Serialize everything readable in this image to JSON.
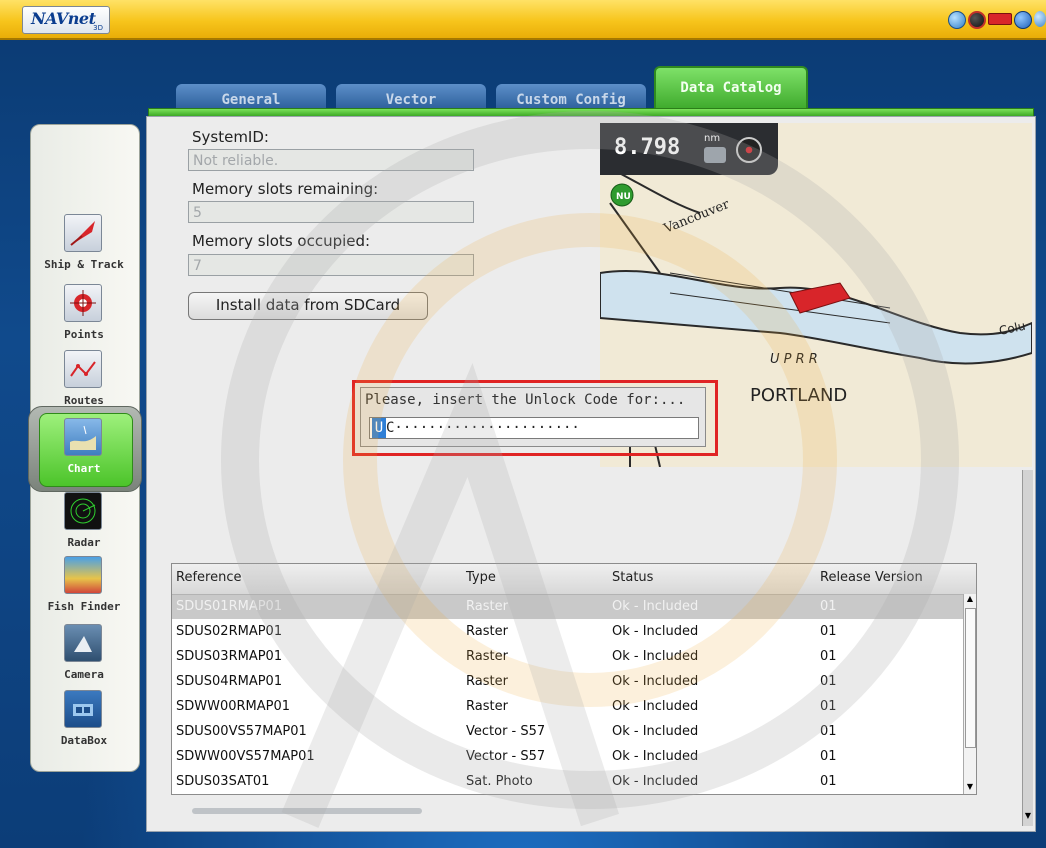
{
  "app": {
    "logo": "NAVnet",
    "logo_sub": "3D"
  },
  "status_icons": [
    {
      "name": "globe-icon",
      "color": "#4a9be0"
    },
    {
      "name": "compass-icon",
      "color": "#c0302a"
    },
    {
      "name": "boat-icon",
      "color": "#d8252a"
    },
    {
      "name": "gps-icon",
      "color": "#2a74d0"
    },
    {
      "name": "sun-icon",
      "color": "#5aa1d8"
    }
  ],
  "tabs": [
    {
      "label": "General"
    },
    {
      "label": "Vector"
    },
    {
      "label": "Custom Config"
    },
    {
      "label": "Data Catalog",
      "active": true
    }
  ],
  "sidebar": {
    "items": [
      {
        "label": "Ship & Track",
        "icon": "ship-track-icon"
      },
      {
        "label": "Points",
        "icon": "points-icon"
      },
      {
        "label": "Routes",
        "icon": "routes-icon"
      },
      {
        "label": "Chart",
        "icon": "chart-icon",
        "active": true
      },
      {
        "label": "Radar",
        "icon": "radar-icon"
      },
      {
        "label": "Fish Finder",
        "icon": "fish-finder-icon"
      },
      {
        "label": "Camera",
        "icon": "camera-icon"
      },
      {
        "label": "DataBox",
        "icon": "databox-icon"
      }
    ]
  },
  "form": {
    "system_id_label": "SystemID:",
    "system_id_value": "Not reliable.",
    "remaining_label": "Memory slots remaining:",
    "remaining_value": "5",
    "occupied_label": "Memory slots occupied:",
    "occupied_value": "7",
    "install_button": "Install data from SDCard"
  },
  "map": {
    "scale_value": "8.798",
    "scale_unit": "nm",
    "labels": [
      "Vancouver",
      "PORTLAND",
      "U P R R",
      "Colu"
    ],
    "badge": "NU"
  },
  "dialog": {
    "title": "Please, insert the Unlock Code for:...",
    "code_selected": "U",
    "code_rest": "C······················"
  },
  "table": {
    "columns": [
      "Reference",
      "Type",
      "Status",
      "Release Version"
    ],
    "rows": [
      [
        "SDUS01RMAP01",
        "Raster",
        "Ok - Included",
        "01"
      ],
      [
        "SDUS02RMAP01",
        "Raster",
        "Ok - Included",
        "01"
      ],
      [
        "SDUS03RMAP01",
        "Raster",
        "Ok - Included",
        "01"
      ],
      [
        "SDUS04RMAP01",
        "Raster",
        "Ok - Included",
        "01"
      ],
      [
        "SDWW00RMAP01",
        "Raster",
        "Ok - Included",
        "01"
      ],
      [
        "SDUS00VS57MAP01",
        "Vector - S57",
        "Ok - Included",
        "01"
      ],
      [
        "SDWW00VS57MAP01",
        "Vector - S57",
        "Ok - Included",
        "01"
      ],
      [
        "SDUS03SAT01",
        "Sat. Photo",
        "Ok - Included",
        "01"
      ]
    ],
    "selected_row": 0
  }
}
